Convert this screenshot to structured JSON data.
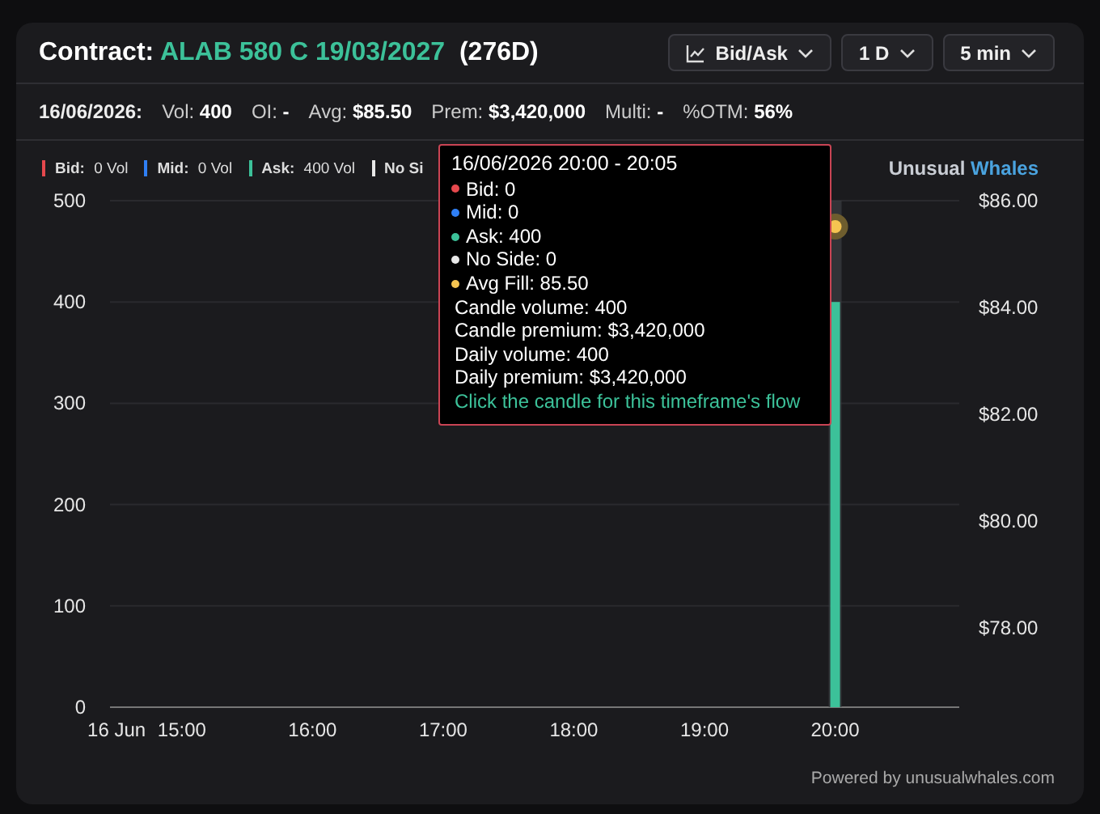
{
  "header": {
    "label": "Contract:",
    "contract": "ALAB 580 C 19/03/2027",
    "days": "(276D)",
    "controls": [
      {
        "kind": "chart",
        "label": "Bid/Ask"
      },
      {
        "kind": "plain",
        "label": "1 D"
      },
      {
        "kind": "plain",
        "label": "5 min"
      }
    ]
  },
  "stats": {
    "date": "16/06/2026:",
    "items": [
      {
        "label": "Vol:",
        "value": "400"
      },
      {
        "label": "OI:",
        "value": "-"
      },
      {
        "label": "Avg:",
        "value": "$85.50"
      },
      {
        "label": "Prem:",
        "value": "$3,420,000"
      },
      {
        "label": "Multi:",
        "value": "-"
      },
      {
        "label": "%OTM:",
        "value": "56%"
      }
    ]
  },
  "legend": [
    {
      "label": "Bid:",
      "value": "0 Vol",
      "color": "#e5484d"
    },
    {
      "label": "Mid:",
      "value": "0 Vol",
      "color": "#2f7ff5"
    },
    {
      "label": "Ask:",
      "value": "400 Vol",
      "color": "#3cc199"
    },
    {
      "label": "No Si",
      "color": "#e8e8e8"
    }
  ],
  "brand": {
    "part_1": "Unusual",
    "part_2": "Whales"
  },
  "chart": {
    "chart_data": {
      "type": "bar",
      "x": [
        20.0
      ],
      "xlim": [
        14.45,
        20.95
      ],
      "xticks": [
        {
          "value": 14.5,
          "label": "16 Jun"
        },
        {
          "value": 15,
          "label": "15:00"
        },
        {
          "value": 16,
          "label": "16:00"
        },
        {
          "value": 17,
          "label": "17:00"
        },
        {
          "value": 18,
          "label": "18:00"
        },
        {
          "value": 19,
          "label": "19:00"
        },
        {
          "value": 20,
          "label": "20:00"
        }
      ],
      "ylim": [
        0,
        500
      ],
      "yticks": [
        0,
        100,
        200,
        300,
        400,
        500
      ],
      "y2lim": [
        76.52,
        86
      ],
      "y2ticks": [
        {
          "value": 78,
          "label": "$78.00"
        },
        {
          "value": 80,
          "label": "$80.00"
        },
        {
          "value": 82,
          "label": "$82.00"
        },
        {
          "value": 84,
          "label": "$84.00"
        },
        {
          "value": 86,
          "label": "$86.00"
        }
      ],
      "grid": true,
      "series": [
        {
          "values": [
            0
          ]
        },
        {
          "values": [
            0
          ]
        },
        {
          "color": "#3cc199",
          "values": [
            400
          ]
        },
        {
          "values": [
            0
          ]
        }
      ]
    },
    "hover_marker": {
      "color": "#f5c451"
    }
  },
  "tooltip": {
    "title": "16/06/2026 20:00 - 20:05",
    "lines": [
      {
        "kind": "dot",
        "color": "#e5484d",
        "text": "Bid: 0"
      },
      {
        "kind": "dot",
        "color": "#2f7ff5",
        "text": "Mid: 0"
      },
      {
        "kind": "dot",
        "color": "#3cc199",
        "text": "Ask: 400"
      },
      {
        "kind": "dot",
        "color": "#e8e8e8",
        "text": "No Side: 0"
      },
      {
        "kind": "dot",
        "color": "#f5c451",
        "text": "Avg Fill: 85.50"
      },
      {
        "kind": "text",
        "text": "Candle volume: 400"
      },
      {
        "kind": "text",
        "text": "Candle premium: $3,420,000"
      },
      {
        "kind": "text",
        "text": "Daily volume: 400"
      },
      {
        "kind": "text",
        "text": "Daily premium: $3,420,000"
      },
      {
        "kind": "link",
        "text": "Click the candle for this timeframe's flow"
      }
    ]
  },
  "footer": "Powered by unusualwhales.com"
}
